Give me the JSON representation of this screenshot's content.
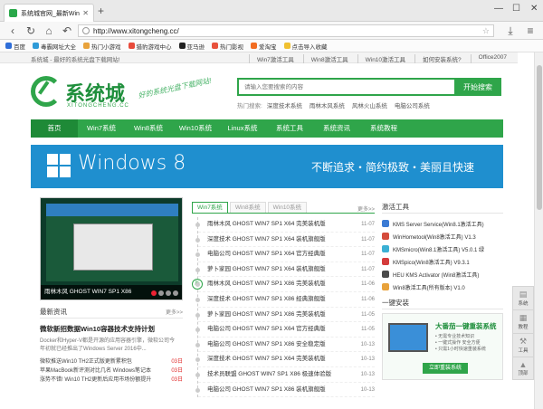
{
  "browser": {
    "tab_title": "系统城官网_最新Windo",
    "url": "http://www.xitongcheng.cc/",
    "bookmarks": [
      "百度",
      "毒霸网址大全",
      "热门小游戏",
      "猎豹游戏中心",
      "亚马逊",
      "热门影视",
      "爱淘宝",
      "点击导入收藏"
    ]
  },
  "topstrip": {
    "slogan": "系统城 - 最好的系统光盘下载网站!",
    "links": [
      "Win7激活工具",
      "Win8激活工具",
      "Win10激活工具",
      "如何安装系统?",
      "Office2007"
    ]
  },
  "logo": {
    "name": "系统城",
    "domain": "XITONGCHENG.CC",
    "tagline": "好的系统光盘下载网站!"
  },
  "search": {
    "placeholder": "请输入您要搜索的内容",
    "button": "开始搜索",
    "hot_label": "热门搜索:",
    "hot": [
      "深度技术系统",
      "雨林木风系统",
      "风林火山系统",
      "电脑公司系统"
    ]
  },
  "nav": [
    "首页",
    "Win7系统",
    "Win8系统",
    "Win10系统",
    "Linux系统",
    "系统工具",
    "系统资讯",
    "系统教程"
  ],
  "banner": {
    "logo_text": "Windows 8",
    "slogan": "不断追求・简约极致・美丽且快速"
  },
  "slide": {
    "caption": "雨林木风 GHOST WIN7 SP1 X86"
  },
  "news": {
    "header": "最新资讯",
    "more": "更多>>",
    "headline": "微软新招数据Win10容器技术支持计划",
    "desc": "Docker和Hyper-V都是开源的应用容器引擎，微软公司今年初就已经推出了Windows Server 2016中...",
    "items": [
      {
        "title": "微软推送Win10 TH2正式版更新累积包",
        "date": "03日"
      },
      {
        "title": "苹果MacBook新评测对比几名 Windows笔记本",
        "date": "03日"
      },
      {
        "title": "涨势不错! Win10 TH2更新后应用市场份额提升",
        "date": "03日"
      }
    ]
  },
  "list": {
    "tabs": [
      "Win7系统",
      "Win8系统",
      "Win10系统"
    ],
    "more": "更多>>",
    "badge": "新",
    "items": [
      {
        "title": "雨林木风 GHOST WIN7 SP1 X64 完美装机版",
        "date": "11-07"
      },
      {
        "title": "深度技术 GHOST WIN7 SP1 X64 装机旗舰版",
        "date": "11-07"
      },
      {
        "title": "电脑公司 GHOST WIN7 SP1 X64 官方经典版",
        "date": "11-07"
      },
      {
        "title": "萝卜家园 GHOST WIN7 SP1 X64 装机旗舰版",
        "date": "11-07"
      },
      {
        "title": "雨林木风 GHOST WIN7 SP1 X86 完美装机版",
        "date": "11-06"
      },
      {
        "title": "深度技术 GHOST WIN7 SP1 X86 经典旗舰版",
        "date": "11-06"
      },
      {
        "title": "萝卜家园 GHOST WIN7 SP1 X86 完美装机版",
        "date": "11-05"
      },
      {
        "title": "电脑公司 GHOST WIN7 SP1 X64 官方经典版",
        "date": "11-05"
      },
      {
        "title": "电脑公司 GHOST WIN7 SP1 X86 安全稳定版",
        "date": "10-13"
      },
      {
        "title": "深度技术 GHOST WIN7 SP1 X64 完美装机版",
        "date": "10-13"
      },
      {
        "title": "技术员联盟 GHOST WIN7 SP1 X86 极速体验版",
        "date": "10-13"
      },
      {
        "title": "电脑公司 GHOST WIN7 SP1 X86 装机旗舰版",
        "date": "10-13"
      }
    ]
  },
  "tools": {
    "header": "激活工具",
    "items": [
      {
        "name": "KMS Server Service(Win8.1激活工具)",
        "color": "#3b7bd4"
      },
      {
        "name": "WinHometool(Win8激活工具) V1.3",
        "color": "#d44b3b"
      },
      {
        "name": "KMSmicro(Win8.1激活工具) V5.0.1 绿",
        "color": "#3bb0d4"
      },
      {
        "name": "KMSpico(Win8激活工具) V9.3.1",
        "color": "#d43b3b"
      },
      {
        "name": "HEU KMS Activator (Win8激活工具)",
        "color": "#4a4a4a"
      },
      {
        "name": "Win8激活工具(所有版本) V1.0",
        "color": "#e8a23b"
      }
    ],
    "install_header": "一键安装",
    "promo_title": "大番茄一键重装系统",
    "promo_lines": [
      "• 无需专业技术知识",
      "• 一键式操作 安全方便",
      "• 只需1小时快速重装系统"
    ],
    "promo_button": "立即重装系统"
  },
  "dock": [
    {
      "glyph": "▤",
      "label": "系统"
    },
    {
      "glyph": "▦",
      "label": "教程"
    },
    {
      "glyph": "⚒",
      "label": "工具"
    },
    {
      "glyph": "▲",
      "label": "顶部"
    }
  ]
}
